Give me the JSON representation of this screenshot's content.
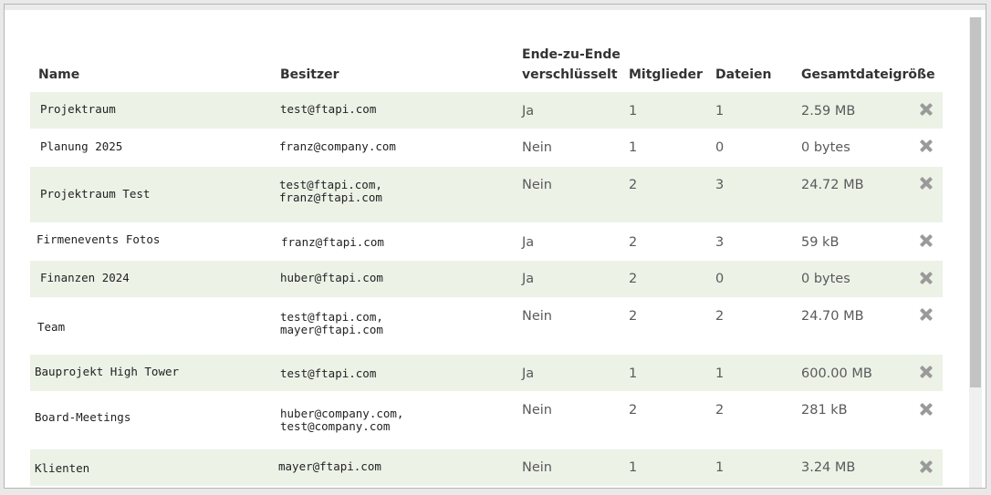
{
  "headers": {
    "name": "Name",
    "owner": "Besitzer",
    "e2e_line1": "Ende-zu-Ende",
    "e2e_line2": "verschlüsselt",
    "members": "Mitglieder",
    "files": "Dateien",
    "total_size": "Gesamtdateigröße"
  },
  "rows": [
    {
      "name": "Projektraum",
      "owners": [
        "test@ftapi.com"
      ],
      "e2e": "Ja",
      "members": "1",
      "files": "1",
      "size": "2.59 MB"
    },
    {
      "name": "Planung 2025",
      "owners": [
        "franz@company.com"
      ],
      "e2e": "Nein",
      "members": "1",
      "files": "0",
      "size": "0 bytes"
    },
    {
      "name": "Projektraum Test",
      "owners": [
        "test@ftapi.com,",
        "franz@ftapi.com"
      ],
      "e2e": "Nein",
      "members": "2",
      "files": "3",
      "size": "24.72 MB"
    },
    {
      "name": "Firmenevents Fotos",
      "owners": [
        "franz@ftapi.com"
      ],
      "e2e": "Ja",
      "members": "2",
      "files": "3",
      "size": "59 kB"
    },
    {
      "name": "Finanzen 2024",
      "owners": [
        "huber@ftapi.com"
      ],
      "e2e": "Ja",
      "members": "2",
      "files": "0",
      "size": "0 bytes"
    },
    {
      "name": "Team",
      "owners": [
        "test@ftapi.com,",
        "mayer@ftapi.com"
      ],
      "e2e": "Nein",
      "members": "2",
      "files": "2",
      "size": "24.70 MB"
    },
    {
      "name": "Bauprojekt High Tower",
      "owners": [
        "test@ftapi.com"
      ],
      "e2e": "Ja",
      "members": "1",
      "files": "1",
      "size": "600.00 MB"
    },
    {
      "name": "Board-Meetings",
      "owners": [
        "huber@company.com,",
        "test@company.com"
      ],
      "e2e": "Nein",
      "members": "2",
      "files": "2",
      "size": "281 kB"
    },
    {
      "name": "Klienten",
      "owners": [
        "mayer@ftapi.com"
      ],
      "e2e": "Nein",
      "members": "1",
      "files": "1",
      "size": "3.24 MB"
    }
  ],
  "colors": {
    "row_alt": "#edf2e7",
    "header_text": "#333333",
    "delete_icon": "#9a9a9a"
  },
  "icons": {
    "delete": "close-x-icon"
  }
}
